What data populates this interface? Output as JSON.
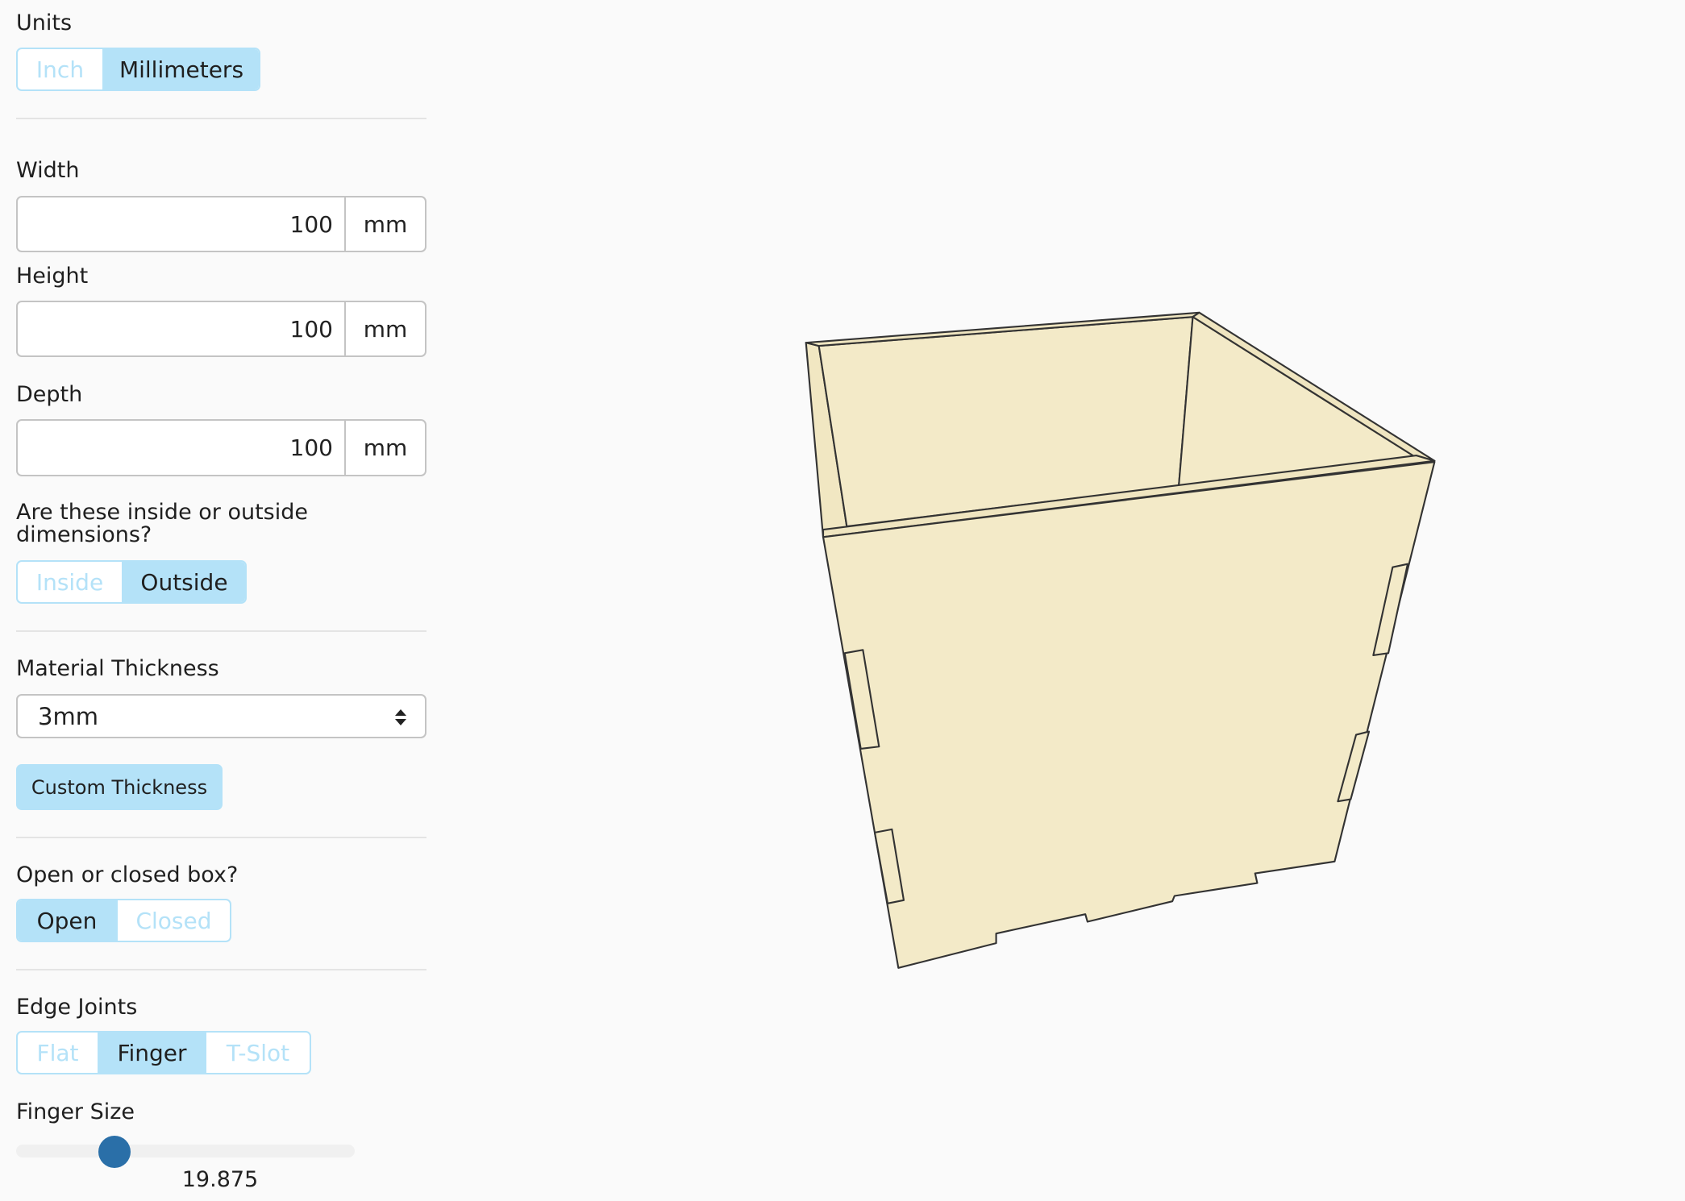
{
  "units": {
    "label": "Units",
    "options": [
      "Inch",
      "Millimeters"
    ],
    "selected": "Millimeters"
  },
  "width": {
    "label": "Width",
    "value": "100",
    "unit": "mm"
  },
  "height": {
    "label": "Height",
    "value": "100",
    "unit": "mm"
  },
  "depth": {
    "label": "Depth",
    "value": "100",
    "unit": "mm"
  },
  "dimensions": {
    "label": "Are these inside or outside dimensions?",
    "options": [
      "Inside",
      "Outside"
    ],
    "selected": "Outside"
  },
  "material": {
    "label": "Material Thickness",
    "selected": "3mm",
    "custom_button": "Custom Thickness"
  },
  "box_type": {
    "label": "Open or closed box?",
    "options": [
      "Open",
      "Closed"
    ],
    "selected": "Open"
  },
  "edge_joints": {
    "label": "Edge Joints",
    "options": [
      "Flat",
      "Finger",
      "T-Slot"
    ],
    "selected": "Finger"
  },
  "finger_size": {
    "label": "Finger Size",
    "value": "19.875",
    "slider_fraction": 0.29
  },
  "colors": {
    "accent": "#b4e2f8",
    "slider_thumb": "#2a6fa8",
    "box_fill": "#f3eac8",
    "box_stroke": "#333333"
  }
}
